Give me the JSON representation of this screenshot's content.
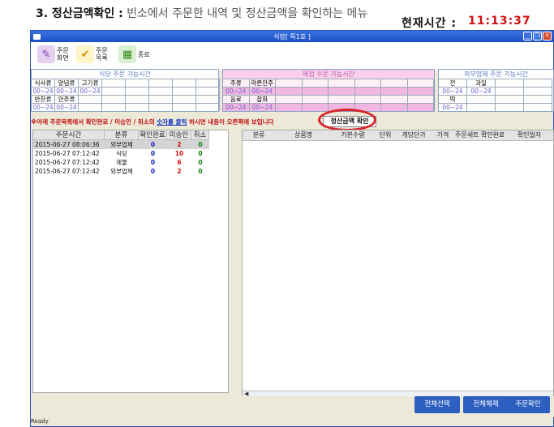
{
  "heading": {
    "title": "3. 정산금액확인 :",
    "desc": "빈소에서 주문한 내역 및 정산금액을 확인하는 메뉴"
  },
  "window": {
    "title": "식장[ 특1호 ]"
  },
  "toolbar": {
    "buttons": [
      {
        "label1": "주문",
        "label2": "화면",
        "icon": "order-screen-icon"
      },
      {
        "label1": "주문",
        "label2": "목록",
        "icon": "order-list-icon"
      },
      {
        "label1": "종료",
        "label2": "",
        "icon": "exit-icon"
      }
    ]
  },
  "clock": {
    "label": "현재시간 :",
    "value": "11:13:37"
  },
  "hours": {
    "restaurant": {
      "title": "식당 주문 가능시간",
      "row1": [
        "식사류",
        "양념류",
        "고기류",
        "",
        "",
        "",
        "",
        ""
      ],
      "row1_time": [
        "00~24",
        "00~24",
        "00~24",
        "",
        "",
        "",
        "",
        ""
      ],
      "row2": [
        "반찬류",
        "안주류",
        "",
        "",
        "",
        "",
        "",
        ""
      ],
      "row2_time": [
        "00~24",
        "00~24",
        "",
        "",
        "",
        "",
        "",
        ""
      ]
    },
    "shop": {
      "title": "매점 주문 가능시간",
      "row1": [
        "주류",
        "마른안주",
        "",
        "",
        "",
        "",
        "",
        ""
      ],
      "row1_time": [
        "00~24",
        "00~24",
        "",
        "",
        "",
        "",
        "",
        ""
      ],
      "row2": [
        "음료",
        "잡화",
        "",
        "",
        "",
        "",
        "",
        ""
      ],
      "row2_time": [
        "00~24",
        "00~24",
        "",
        "",
        "",
        "",
        "",
        ""
      ]
    },
    "vendor": {
      "title": "외부업체 주문 가능시간",
      "row1": [
        "전",
        "과일",
        "",
        ""
      ],
      "row1_time": [
        "00~24",
        "00~24",
        "",
        ""
      ],
      "row2": [
        "떡",
        "",
        "",
        ""
      ],
      "row2_time": [
        "00~24",
        "",
        "",
        ""
      ]
    }
  },
  "notice": {
    "part1": "※아래 주문목록에서 확인완료 / 미승인 / 취소의 ",
    "link": "숫자를 클릭",
    "part2": " 하시면 내용이 오른쪽에 보입니다"
  },
  "settle_button": "정산금액 확인",
  "left_table": {
    "headers": [
      "주문시간",
      "분류",
      "확인완료",
      "미승인",
      "취소"
    ],
    "rows": [
      {
        "time": "2015-06-27 08:06:36",
        "category": "외부업체",
        "confirmed": "0",
        "pending": "2",
        "cancelled": "0"
      },
      {
        "time": "2015-06-27 07:12:42",
        "category": "식당",
        "confirmed": "0",
        "pending": "10",
        "cancelled": "0"
      },
      {
        "time": "2015-06-27 07:12:42",
        "category": "제물",
        "confirmed": "0",
        "pending": "6",
        "cancelled": "0"
      },
      {
        "time": "2015-06-27 07:12:42",
        "category": "외부업체",
        "confirmed": "0",
        "pending": "2",
        "cancelled": "0"
      }
    ]
  },
  "right_table": {
    "headers": [
      "분류",
      "상품명",
      "기본수량",
      "단위",
      "개당단가",
      "가격",
      "주문세트 확인완료",
      "확인일자"
    ]
  },
  "footer": {
    "select_all": "전체선택",
    "deselect_all": "전체해제",
    "confirm_order": "주문확인"
  },
  "status": "Ready",
  "colors": {
    "titlebar": "#1b4fc4",
    "accent": "#2d5fc0",
    "alert": "#d01010",
    "highlight": "#d8242b"
  }
}
